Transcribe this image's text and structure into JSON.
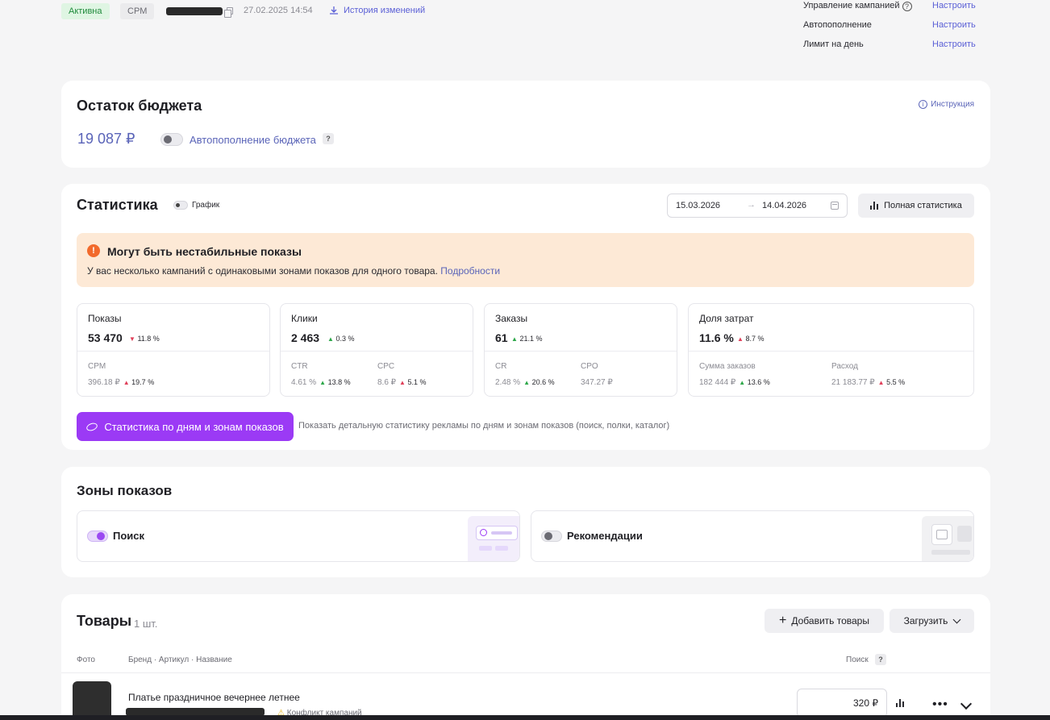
{
  "topbar": {
    "status_badge": "Активна",
    "type_badge": "CPM",
    "datetime": "27.02.2025 14:54",
    "history_link": "История изменений",
    "settings": [
      {
        "label": "Управление кампанией",
        "action": "Настроить"
      },
      {
        "label": "Автопополнение",
        "action": "Настроить"
      },
      {
        "label": "Лимит на день",
        "action": "Настроить"
      }
    ]
  },
  "budget": {
    "title": "Остаток бюджета",
    "amount": "19 087 ₽",
    "autorefill_label": "Автопополнение бюджета",
    "help": "?",
    "instruction_link": "Инструкция"
  },
  "stats": {
    "title": "Статистика",
    "graph_toggle_label": "График",
    "date_from": "15.03.2026",
    "date_arrow": "→",
    "date_to": "14.04.2026",
    "full_stats_button": "Полная статистика",
    "warning": {
      "title": "Могут быть нестабильные показы",
      "text": "У вас несколько кампаний с одинаковыми зонами показов для одного товара.",
      "link": "Подробности"
    },
    "metrics": [
      {
        "title": "Показы",
        "value": "53 470",
        "delta": "11.8 %",
        "trend": "down",
        "subs": [
          {
            "label": "CPM",
            "value": "396.18 ₽",
            "delta": "19.7 %",
            "trend": "down"
          }
        ]
      },
      {
        "title": "Клики",
        "value": "2 463",
        "delta": "0.3 %",
        "trend": "up",
        "subs": [
          {
            "label": "CTR",
            "value": "4.61 %",
            "delta": "13.8 %",
            "trend": "up"
          },
          {
            "label": "CPC",
            "value": "8.6 ₽",
            "delta": "5.1 %",
            "trend": "down"
          }
        ]
      },
      {
        "title": "Заказы",
        "value": "61",
        "delta": "21.1 %",
        "trend": "up",
        "subs": [
          {
            "label": "CR",
            "value": "2.48 %",
            "delta": "20.6 %",
            "trend": "up"
          },
          {
            "label": "CPO",
            "value": "347.27 ₽",
            "delta": "",
            "trend": ""
          }
        ]
      },
      {
        "title": "Доля затрат",
        "value": "11.6 %",
        "delta": "8.7 %",
        "trend": "down",
        "subs": [
          {
            "label": "Сумма заказов",
            "value": "182 444 ₽",
            "delta": "13.6 %",
            "trend": "up"
          },
          {
            "label": "Расход",
            "value": "21 183.77 ₽",
            "delta": "5.5 %",
            "trend": "down"
          }
        ]
      }
    ],
    "daily_button": "Статистика по дням и зонам показов",
    "daily_hint": "Показать детальную статистику рекламы по дням и зонам показов (поиск, полки, каталог)"
  },
  "zones": {
    "title": "Зоны показов",
    "items": [
      {
        "label": "Поиск",
        "enabled": true
      },
      {
        "label": "Рекомендации",
        "enabled": false
      }
    ]
  },
  "goods": {
    "title": "Товары",
    "count": "1 шт.",
    "add_button": "Добавить товары",
    "load_button": "Загрузить",
    "columns": {
      "photo": "Фото",
      "brand": "Бренд · Артикул · Название",
      "search": "Поиск",
      "search_help": "?"
    },
    "rows": [
      {
        "name": "Платье праздничное вечернее летнее",
        "conflict": "Конфликт кампаний",
        "search_bid": "320 ₽",
        "menu": "•••"
      }
    ]
  },
  "colors": {
    "accent": "#9b3af5",
    "link": "#5a64b8",
    "warning_bg": "#fde9d6",
    "up": "#2ea84a",
    "down": "#e0405a"
  }
}
